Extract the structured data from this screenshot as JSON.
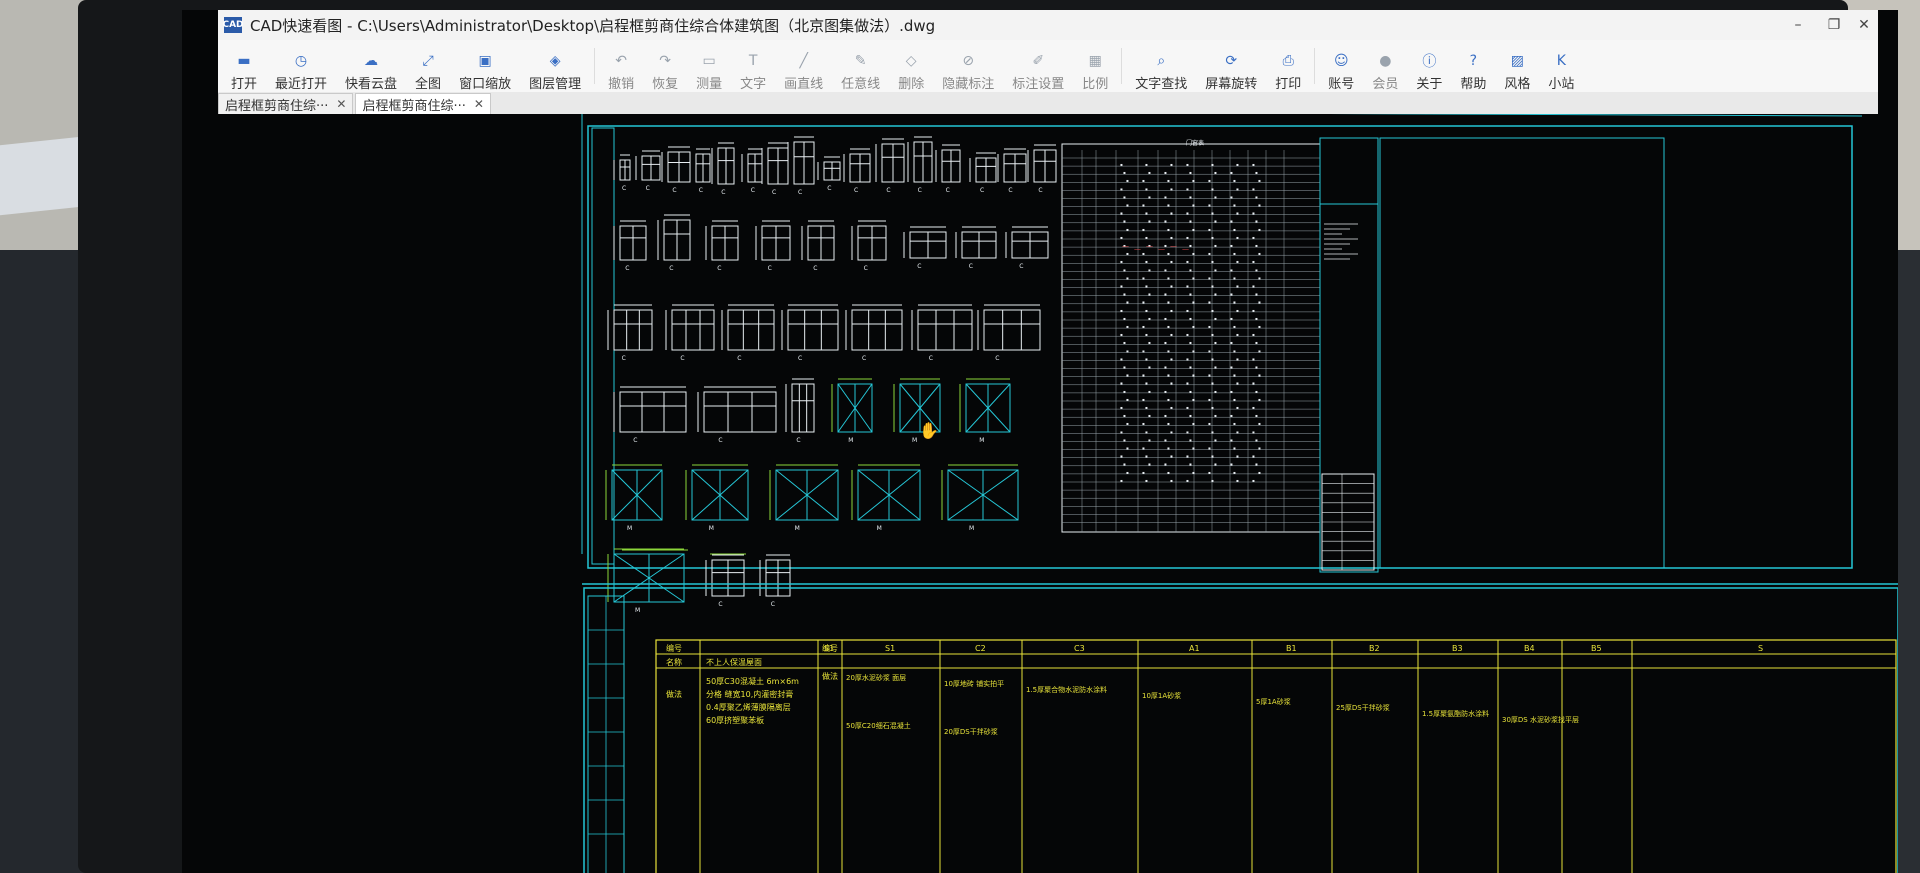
{
  "window": {
    "app_badge": "CAD",
    "title": "CAD快速看图 - C:\\Users\\Administrator\\Desktop\\启程框剪商住综合体建筑图（北京图集做法）.dwg",
    "minimize_glyph": "–",
    "maximize_glyph": "❐",
    "close_glyph": "✕"
  },
  "toolbar": {
    "items": [
      {
        "label": "打开",
        "icon": "folder-icon",
        "glyph": "▬",
        "enabled": true
      },
      {
        "label": "最近打开",
        "icon": "history-icon",
        "glyph": "◷",
        "enabled": true
      },
      {
        "label": "快看云盘",
        "icon": "cloud-icon",
        "glyph": "☁",
        "enabled": true
      },
      {
        "label": "全图",
        "icon": "full-extent-icon",
        "glyph": "⤢",
        "enabled": true
      },
      {
        "label": "窗口缩放",
        "icon": "window-zoom-icon",
        "glyph": "▣",
        "enabled": true
      },
      {
        "label": "图层管理",
        "icon": "layers-icon",
        "glyph": "◈",
        "enabled": true
      },
      {
        "label": "撤销",
        "icon": "undo-icon",
        "glyph": "↶",
        "enabled": false
      },
      {
        "label": "恢复",
        "icon": "redo-icon",
        "glyph": "↷",
        "enabled": false
      },
      {
        "label": "测量",
        "icon": "ruler-icon",
        "glyph": "▭",
        "enabled": false
      },
      {
        "label": "文字",
        "icon": "text-icon",
        "glyph": "T",
        "enabled": false
      },
      {
        "label": "画直线",
        "icon": "line-icon",
        "glyph": "╱",
        "enabled": false
      },
      {
        "label": "任意线",
        "icon": "freehand-icon",
        "glyph": "✎",
        "enabled": false
      },
      {
        "label": "删除",
        "icon": "eraser-icon",
        "glyph": "◇",
        "enabled": false
      },
      {
        "label": "隐藏标注",
        "icon": "hide-annotation-icon",
        "glyph": "⊘",
        "enabled": false
      },
      {
        "label": "标注设置",
        "icon": "annotation-settings-icon",
        "glyph": "✐",
        "enabled": false
      },
      {
        "label": "比例",
        "icon": "scale-icon",
        "glyph": "▦",
        "enabled": false
      },
      {
        "label": "文字查找",
        "icon": "text-search-icon",
        "glyph": "⌕",
        "enabled": true
      },
      {
        "label": "屏幕旋转",
        "icon": "rotate-screen-icon",
        "glyph": "⟳",
        "enabled": true
      },
      {
        "label": "打印",
        "icon": "printer-icon",
        "glyph": "⎙",
        "enabled": true
      },
      {
        "label": "账号",
        "icon": "user-icon",
        "glyph": "☺",
        "enabled": true
      },
      {
        "label": "会员",
        "icon": "vip-icon",
        "glyph": "●",
        "enabled": false
      },
      {
        "label": "关于",
        "icon": "info-icon",
        "glyph": "ⓘ",
        "enabled": true
      },
      {
        "label": "帮助",
        "icon": "help-icon",
        "glyph": "?",
        "enabled": true
      },
      {
        "label": "风格",
        "icon": "style-icon",
        "glyph": "▨",
        "enabled": true
      },
      {
        "label": "小站",
        "icon": "k-site-icon",
        "glyph": "K",
        "enabled": true
      }
    ]
  },
  "tabs": [
    {
      "label": "启程框剪商住综···",
      "active": false,
      "close": "✕"
    },
    {
      "label": "启程框剪商住综···",
      "active": true,
      "close": "✕"
    }
  ],
  "drawing": {
    "header_label": "门窗表",
    "yellow_table": {
      "row_headers": [
        "编号",
        "名称",
        "做法"
      ],
      "columns": [
        "S1",
        "S1",
        "C2",
        "C3",
        "A1",
        "B1",
        "B2",
        "B3",
        "B4",
        "B5",
        "S"
      ],
      "first_col_text": [
        "不上人保温屋面",
        "50厚C30混凝土 6m×6m",
        "分格 缝宽10,内灌密封膏",
        "0.4厚聚乙烯薄膜隔离层",
        "60厚挤塑聚苯板"
      ],
      "cell_texts": [
        "20厚水泥砂浆 面层",
        "10厚地砖 铺实拍平",
        "1.5厚聚合物水泥防水涂料",
        "10厚1A砂浆",
        "5厚1A砂浆",
        "25厚DS干拌砂浆",
        "1.5厚聚氨酯防水涂料",
        "30厚DS 水泥砂浆找平层",
        "50厚C20细石混凝土",
        "20厚DS干拌砂浆"
      ]
    },
    "colors": {
      "cyan": "#25c6d6",
      "white": "#e8eef2",
      "green": "#8cd63a",
      "yellow": "#e8e33a",
      "red": "#e04a4a"
    }
  }
}
